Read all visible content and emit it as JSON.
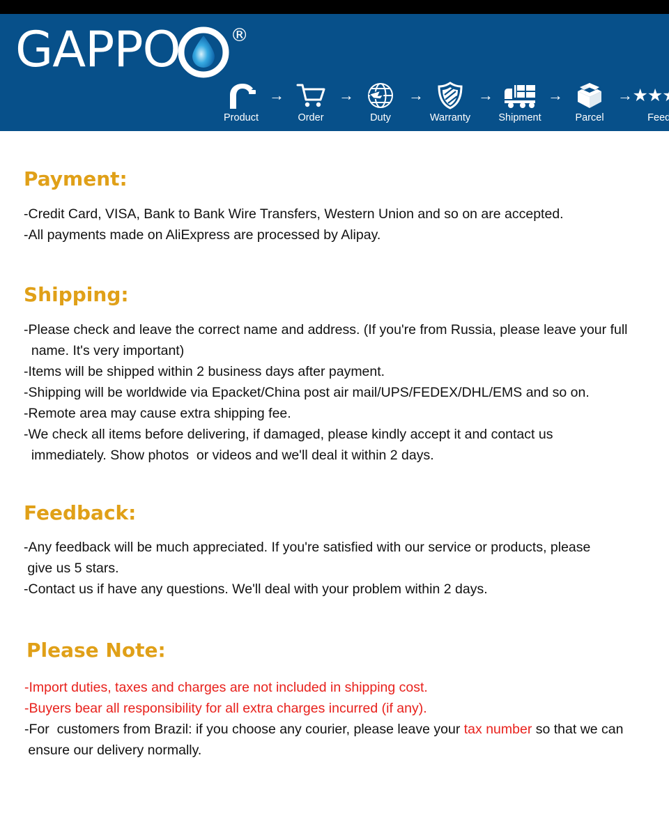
{
  "colors": {
    "banner_blue": "#07508a",
    "heading_gold": "#e0a018",
    "alert_red": "#e8211c",
    "topbar_black": "#000000",
    "text_black": "#111111"
  },
  "header": {
    "brand": "GAPPO",
    "registered_mark": "®",
    "logo_icon": "water-drop-icon",
    "process": {
      "arrow": "→",
      "stars": "★★★★★",
      "steps": [
        {
          "label": "Product",
          "icon": "faucet-icon"
        },
        {
          "label": "Order",
          "icon": "shopping-cart-icon"
        },
        {
          "label": "Duty",
          "icon": "globe-airplane-icon"
        },
        {
          "label": "Warranty",
          "icon": "shield-icon"
        },
        {
          "label": "Shipment",
          "icon": "delivery-truck-icon"
        },
        {
          "label": "Parcel",
          "icon": "open-box-icon"
        },
        {
          "label": "Feedback",
          "icon": "five-stars-icon"
        }
      ]
    }
  },
  "ghost_line": "",
  "sections": {
    "payment": {
      "title": "Payment:",
      "lines": [
        "-Credit Card, VISA, Bank to Bank Wire Transfers, Western Union and so on are accepted.",
        "-All payments made on AliExpress are processed by Alipay."
      ]
    },
    "shipping": {
      "title": "Shipping:",
      "lines": [
        "-Please check and leave the correct name and address. (If you're from Russia, please leave your full\n  name. It's very important)",
        "-Items will be shipped within 2 business days after payment.",
        "-Shipping will be worldwide via Epacket/China post air mail/UPS/FEDEX/DHL/EMS and so on.",
        "-Remote area may cause extra shipping fee.",
        "-We check all items before delivering, if damaged, please kindly accept it and contact us\n  immediately. Show photos  or videos and we'll deal it within 2 days."
      ]
    },
    "feedback": {
      "title": "Feedback:",
      "lines": [
        "-Any feedback will be much appreciated. If you're satisfied with our service or products, please\n give us 5 stars.",
        "-Contact us if have any questions. We'll deal with your problem within 2 days."
      ]
    },
    "please_note": {
      "title": "Please Note:",
      "lines": [
        "-Import duties, taxes and charges are not included in shipping cost.",
        "-Buyers bear all responsibility for all extra charges incurred (if any)."
      ],
      "brazil_line": {
        "before": "-For  customers from Brazil: if you choose any courier, please leave your ",
        "highlight": "tax number",
        "after": " so that we can\n ensure our delivery normally."
      }
    }
  }
}
